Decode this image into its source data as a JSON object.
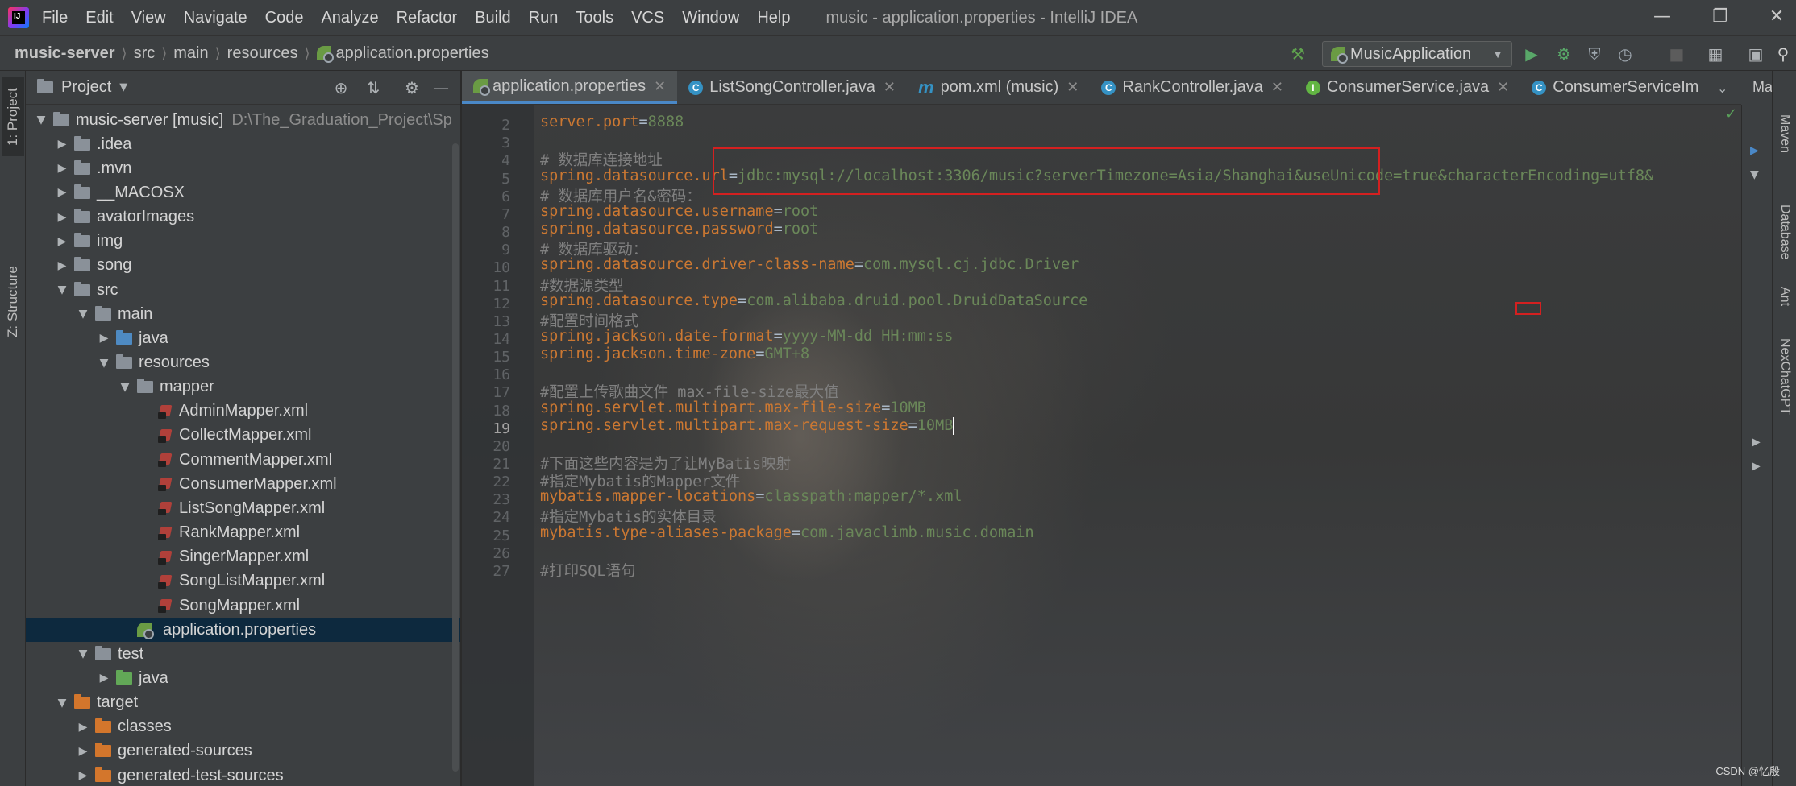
{
  "menubar": {
    "items": [
      "File",
      "Edit",
      "View",
      "Navigate",
      "Code",
      "Analyze",
      "Refactor",
      "Build",
      "Run",
      "Tools",
      "VCS",
      "Window",
      "Help"
    ],
    "window_title": "music - application.properties - IntelliJ IDEA"
  },
  "navbar": {
    "breadcrumbs": [
      "music-server",
      "src",
      "main",
      "resources",
      "application.properties"
    ],
    "run_config": "MusicApplication"
  },
  "left_stripe": {
    "project_tab": "1: Project",
    "structure_tab": "Z: Structure"
  },
  "project_panel": {
    "title": "Project",
    "tree": [
      {
        "label": "music-server [music]",
        "path": "D:\\The_Graduation_Project\\Sp",
        "depth": 0,
        "expanded": true,
        "type": "module"
      },
      {
        "label": ".idea",
        "depth": 1,
        "expanded": false,
        "type": "folder"
      },
      {
        "label": ".mvn",
        "depth": 1,
        "expanded": false,
        "type": "folder"
      },
      {
        "label": "__MACOSX",
        "depth": 1,
        "expanded": false,
        "type": "folder"
      },
      {
        "label": "avatorImages",
        "depth": 1,
        "expanded": false,
        "type": "folder"
      },
      {
        "label": "img",
        "depth": 1,
        "expanded": false,
        "type": "folder"
      },
      {
        "label": "song",
        "depth": 1,
        "expanded": false,
        "type": "folder"
      },
      {
        "label": "src",
        "depth": 1,
        "expanded": true,
        "type": "folder"
      },
      {
        "label": "main",
        "depth": 2,
        "expanded": true,
        "type": "folder"
      },
      {
        "label": "java",
        "depth": 3,
        "expanded": false,
        "type": "folder-blue"
      },
      {
        "label": "resources",
        "depth": 3,
        "expanded": true,
        "type": "folder-res"
      },
      {
        "label": "mapper",
        "depth": 4,
        "expanded": true,
        "type": "folder"
      },
      {
        "label": "AdminMapper.xml",
        "depth": 5,
        "type": "xml"
      },
      {
        "label": "CollectMapper.xml",
        "depth": 5,
        "type": "xml"
      },
      {
        "label": "CommentMapper.xml",
        "depth": 5,
        "type": "xml"
      },
      {
        "label": "ConsumerMapper.xml",
        "depth": 5,
        "type": "xml"
      },
      {
        "label": "ListSongMapper.xml",
        "depth": 5,
        "type": "xml"
      },
      {
        "label": "RankMapper.xml",
        "depth": 5,
        "type": "xml"
      },
      {
        "label": "SingerMapper.xml",
        "depth": 5,
        "type": "xml"
      },
      {
        "label": "SongListMapper.xml",
        "depth": 5,
        "type": "xml"
      },
      {
        "label": "SongMapper.xml",
        "depth": 5,
        "type": "xml"
      },
      {
        "label": "application.properties",
        "depth": 4,
        "type": "properties",
        "selected": true
      },
      {
        "label": "test",
        "depth": 2,
        "expanded": true,
        "type": "folder"
      },
      {
        "label": "java",
        "depth": 3,
        "expanded": false,
        "type": "folder-green"
      },
      {
        "label": "target",
        "depth": 1,
        "expanded": true,
        "type": "folder-orange"
      },
      {
        "label": "classes",
        "depth": 2,
        "expanded": false,
        "type": "folder-orange"
      },
      {
        "label": "generated-sources",
        "depth": 2,
        "expanded": false,
        "type": "folder-orange"
      },
      {
        "label": "generated-test-sources",
        "depth": 2,
        "expanded": false,
        "type": "folder-orange"
      }
    ]
  },
  "editor_tabs": [
    {
      "label": "application.properties",
      "icon": "properties-icon",
      "active": true
    },
    {
      "label": "ListSongController.java",
      "icon": "class-icon"
    },
    {
      "label": "pom.xml (music)",
      "icon": "maven-icon"
    },
    {
      "label": "RankController.java",
      "icon": "class-icon"
    },
    {
      "label": "ConsumerService.java",
      "icon": "interface-icon"
    },
    {
      "label": "ConsumerServiceIm",
      "icon": "class-icon"
    }
  ],
  "editor": {
    "current_line": 19,
    "lines": [
      {
        "n": 2,
        "key": "server.port",
        "value": "8888"
      },
      {
        "n": 3
      },
      {
        "n": 4,
        "comment": "# 数据库连接地址"
      },
      {
        "n": 5,
        "key": "spring.datasource.url",
        "value": "jdbc:mysql://localhost:3306/music?serverTimezone=Asia/Shanghai&useUnicode=true&characterEncoding=utf8&"
      },
      {
        "n": 6,
        "comment": "# 数据库用户名&密码："
      },
      {
        "n": 7,
        "key": "spring.datasource.username",
        "value": "root"
      },
      {
        "n": 8,
        "key": "spring.datasource.password",
        "value": "root"
      },
      {
        "n": 9,
        "comment": "# 数据库驱动："
      },
      {
        "n": 10,
        "key": "spring.datasource.driver-class-name",
        "value": "com.mysql.cj.jdbc.Driver"
      },
      {
        "n": 11,
        "comment": "#数据源类型"
      },
      {
        "n": 12,
        "key": "spring.datasource.type",
        "value": "com.alibaba.druid.pool.DruidDataSource"
      },
      {
        "n": 13,
        "comment": "#配置时间格式"
      },
      {
        "n": 14,
        "key": "spring.jackson.date-format",
        "value": "yyyy-MM-dd HH:mm:ss"
      },
      {
        "n": 15,
        "key": "spring.jackson.time-zone",
        "value": "GMT+8"
      },
      {
        "n": 16
      },
      {
        "n": 17,
        "comment": "#配置上传歌曲文件 max-file-size最大值"
      },
      {
        "n": 18,
        "key": "spring.servlet.multipart.max-file-size",
        "value": "10MB"
      },
      {
        "n": 19,
        "key": "spring.servlet.multipart.max-request-size",
        "value": "10MB"
      },
      {
        "n": 20
      },
      {
        "n": 21,
        "comment": "#下面这些内容是为了让MyBatis映射"
      },
      {
        "n": 22,
        "comment": "#指定Mybatis的Mapper文件"
      },
      {
        "n": 23,
        "key": "mybatis.mapper-locations",
        "value": "classpath:mapper/*.xml"
      },
      {
        "n": 24,
        "comment": "#指定Mybatis的实体目录"
      },
      {
        "n": 25,
        "key": "mybatis.type-aliases-package",
        "value": "com.javaclimb.music.domain"
      },
      {
        "n": 26
      },
      {
        "n": 27,
        "comment": "#打印SQL语句"
      }
    ]
  },
  "right_stripe": {
    "maven": "Maven",
    "database": "Database",
    "ant": "Ant",
    "nexchatgpt": "NexChatGPT"
  },
  "maven_panel_title": "Mav",
  "watermark": "CSDN @忆殷"
}
